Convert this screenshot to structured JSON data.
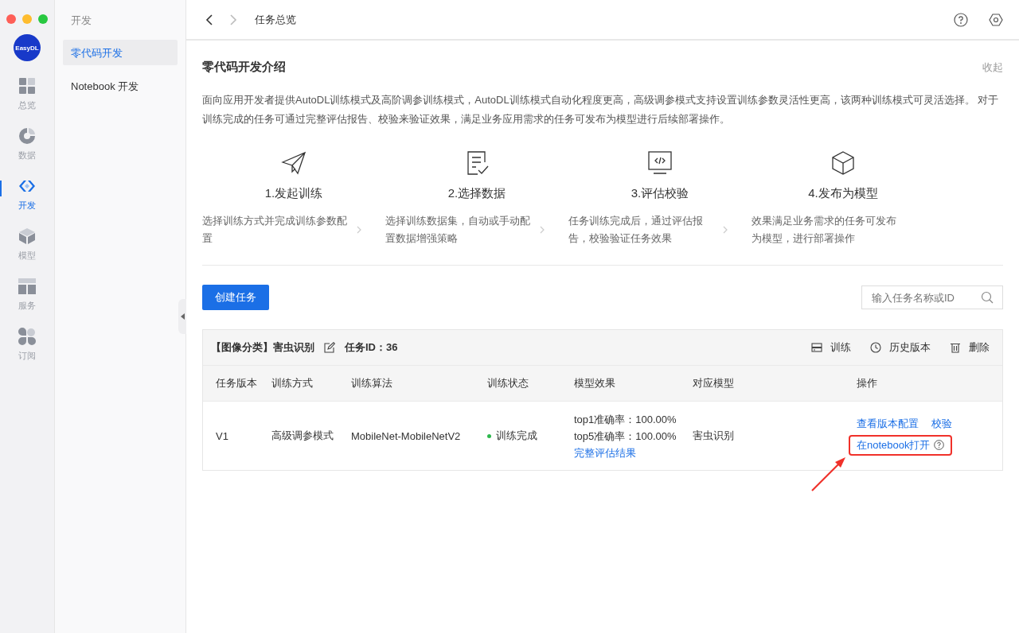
{
  "rail": {
    "logo": "EasyDL",
    "items": [
      {
        "label": "总览",
        "selected": false
      },
      {
        "label": "数据",
        "selected": false
      },
      {
        "label": "开发",
        "selected": true
      },
      {
        "label": "模型",
        "selected": false
      },
      {
        "label": "服务",
        "selected": false
      },
      {
        "label": "订阅",
        "selected": false
      }
    ]
  },
  "sidebar": {
    "heading": "开发",
    "items": [
      {
        "label": "零代码开发",
        "selected": true
      },
      {
        "label": "Notebook 开发",
        "selected": false
      }
    ]
  },
  "topbar": {
    "title": "任务总览"
  },
  "intro": {
    "title": "零代码开发介绍",
    "collapse": "收起",
    "description": "面向应用开发者提供AutoDL训练模式及高阶调参训练模式，AutoDL训练模式自动化程度更高，高级调参模式支持设置训练参数灵活性更高，该两种训练模式可灵活选择。 对于训练完成的任务可通过完整评估报告、校验来验证效果，满足业务应用需求的任务可发布为模型进行后续部署操作。",
    "steps": [
      {
        "title": "1.发起训练",
        "desc": "选择训练方式并完成训练参数配置"
      },
      {
        "title": "2.选择数据",
        "desc": "选择训练数据集，自动或手动配置数据增强策略"
      },
      {
        "title": "3.评估校验",
        "desc": "任务训练完成后，通过评估报告，校验验证任务效果"
      },
      {
        "title": "4.发布为模型",
        "desc": "效果满足业务需求的任务可发布为模型，进行部署操作"
      }
    ]
  },
  "create_button": "创建任务",
  "search": {
    "placeholder": "输入任务名称或ID"
  },
  "task": {
    "name": "【图像分类】害虫识别",
    "id": "任务ID：36",
    "actions": [
      "训练",
      "历史版本",
      "删除"
    ],
    "columns": [
      "任务版本",
      "训练方式",
      "训练算法",
      "训练状态",
      "模型效果",
      "对应模型",
      "操作"
    ],
    "rows": [
      {
        "version": "V1",
        "mode": "高级调参模式",
        "algorithm": "MobileNet-MobileNetV2",
        "status": {
          "text": "训练完成",
          "color": "#2db84d"
        },
        "effects": [
          "top1准确率：100.00%",
          "top5准确率：100.00%"
        ],
        "effect_link": "完整评估结果",
        "model": "害虫识别",
        "links": [
          "查看版本配置",
          "校验"
        ],
        "notebook_link": {
          "label": "在notebook打开",
          "highlighted": true
        }
      }
    ]
  }
}
